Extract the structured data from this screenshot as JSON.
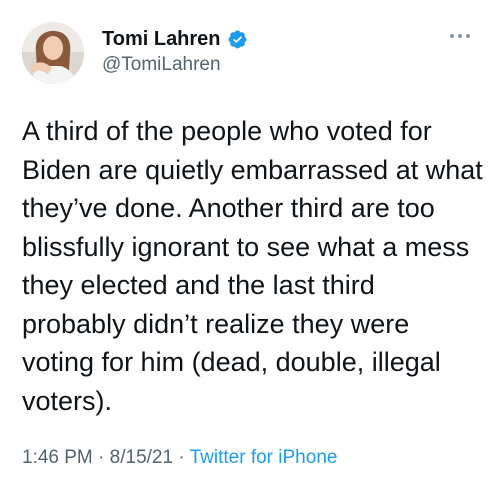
{
  "author": {
    "display_name": "Tomi Lahren",
    "handle": "@TomiLahren",
    "verified": true,
    "verified_color": "#1d9bf0"
  },
  "tweet": {
    "text": "A third of the people who voted for Biden are quietly embarrassed at what they’ve done. Another third are too blissfully ignorant to see what a mess they elected and the last third probably didn’t realize they were voting for him (dead, double, illegal voters)."
  },
  "meta": {
    "time": "1:46 PM",
    "separator_1": " · ",
    "date": "8/15/21",
    "separator_2": " · ",
    "source": "Twitter for iPhone"
  },
  "icons": {
    "more": "more-options-icon",
    "verified": "verified-badge-icon"
  },
  "colors": {
    "text_primary": "#0f1419",
    "text_secondary": "#536471",
    "accent": "#1d9bf0"
  }
}
